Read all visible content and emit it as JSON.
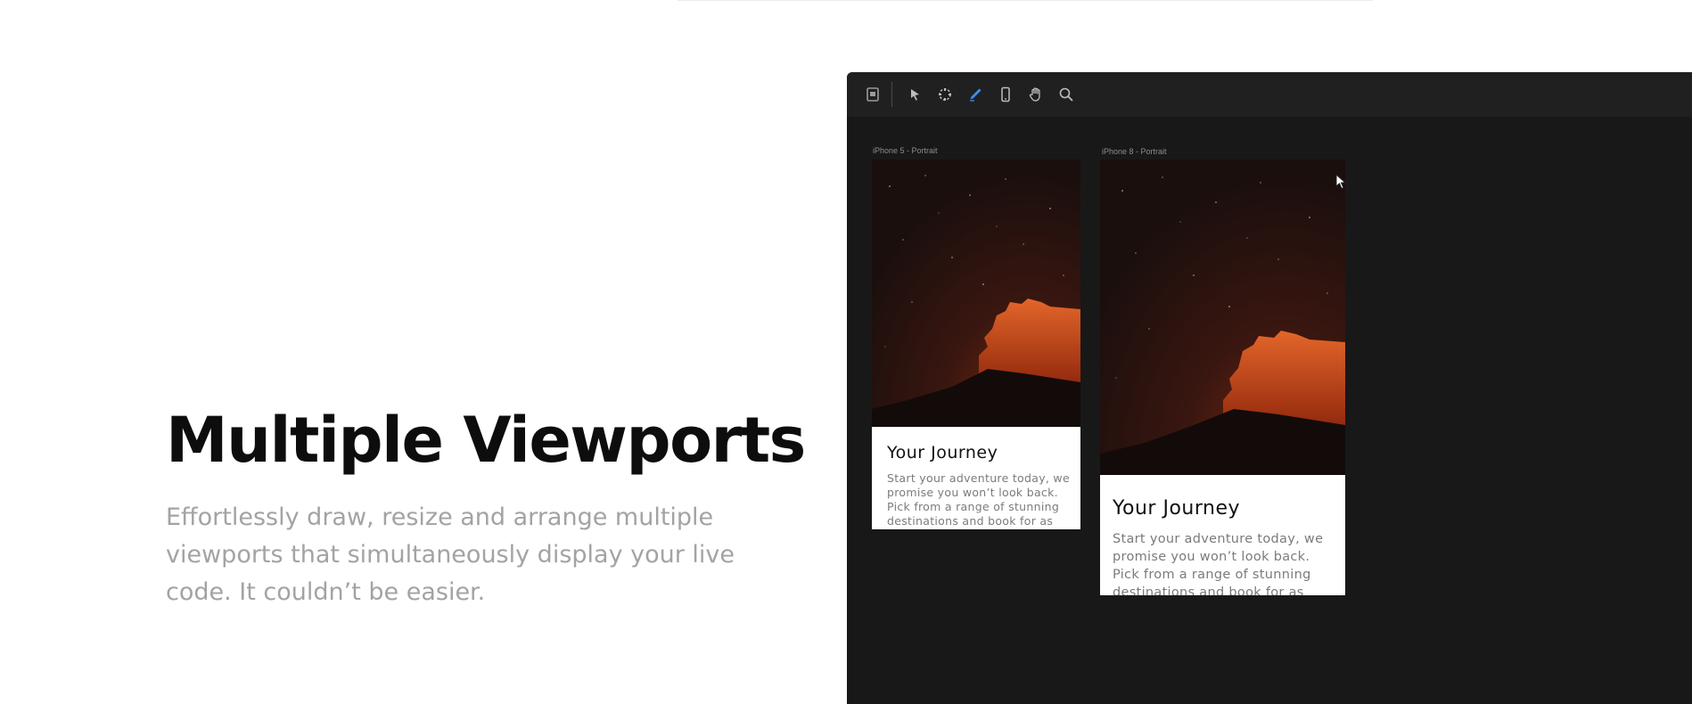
{
  "hero": {
    "title": "Multiple Viewports",
    "description": "Effortlessly draw, resize and arrange multiple viewports that simultaneously display your live code. It couldn’t be easier."
  },
  "toolbar": {
    "tools": [
      {
        "name": "document-icon",
        "active": false
      },
      {
        "name": "pointer-icon",
        "active": false
      },
      {
        "name": "marquee-select-icon",
        "active": false
      },
      {
        "name": "pen-icon",
        "active": true
      },
      {
        "name": "device-icon",
        "active": false
      },
      {
        "name": "hand-icon",
        "active": false
      },
      {
        "name": "search-icon",
        "active": false
      }
    ],
    "active_color": "#3b8ff0"
  },
  "viewports": [
    {
      "label": "iPhone 5 - Portrait",
      "card_title": "Your Journey",
      "card_text": "Start your adventure today, we promise you won’t look back. Pick from a range of stunning destinations and book for as"
    },
    {
      "label": "iPhone 8 - Portrait",
      "card_title": "Your Journey",
      "card_text": "Start your adventure today, we promise you won’t look back. Pick from a range of stunning destinations and book for as"
    }
  ]
}
